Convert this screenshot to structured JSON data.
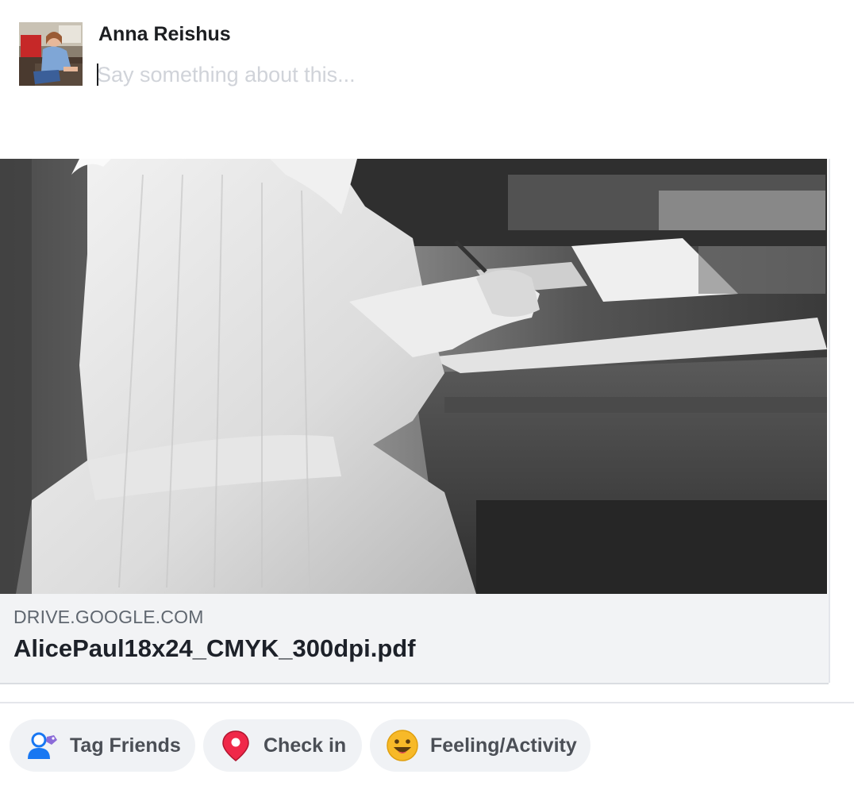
{
  "composer": {
    "user_name": "Anna Reishus",
    "input_placeholder": "Say something about this...",
    "input_value": ""
  },
  "link_preview": {
    "domain": "DRIVE.GOOGLE.COM",
    "title": "AlicePaul18x24_CMYK_300dpi.pdf"
  },
  "actions": [
    {
      "label": "Tag Friends",
      "icon": "tag-friends-icon"
    },
    {
      "label": "Check in",
      "icon": "location-pin-icon"
    },
    {
      "label": "Feeling/Activity",
      "icon": "smiley-icon"
    }
  ],
  "colors": {
    "accent_blue": "#1877f2",
    "pin_red": "#f02849",
    "smiley_yellow": "#f7b928",
    "button_bg": "#f0f2f5"
  }
}
